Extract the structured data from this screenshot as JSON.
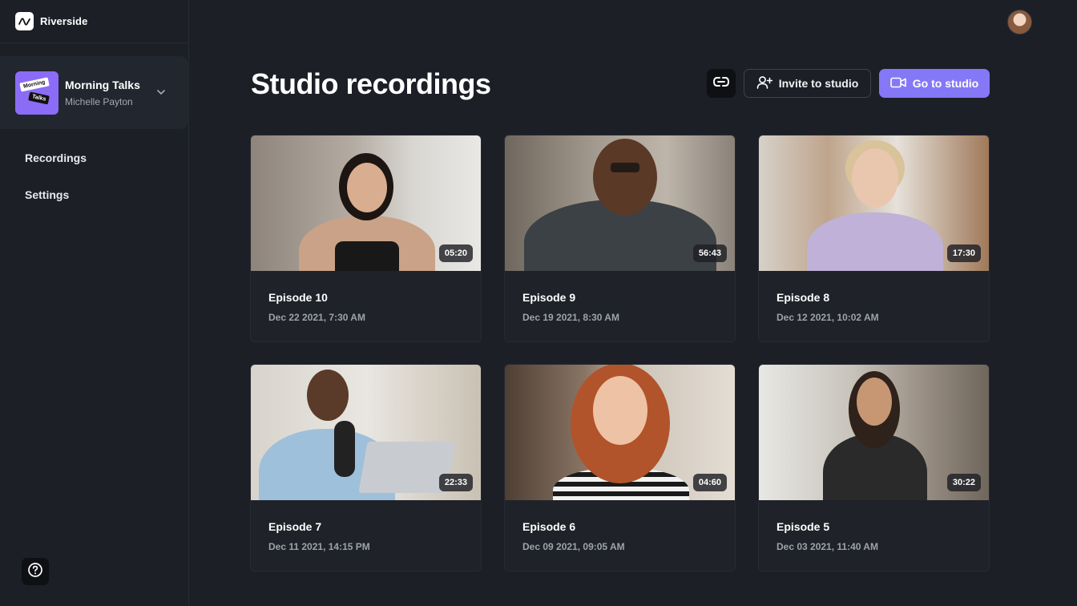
{
  "app": {
    "name": "Riverside"
  },
  "studio": {
    "name": "Morning Talks",
    "owner": "Michelle Payton",
    "thumb_line1": "Morning",
    "thumb_line2": "Talks",
    "thumb_color": "#8b6cf6"
  },
  "nav": {
    "items": [
      {
        "label": "Recordings"
      },
      {
        "label": "Settings"
      }
    ]
  },
  "header": {
    "title": "Studio recordings",
    "invite_label": "Invite to studio",
    "go_label": "Go to studio",
    "accent": "#8578f7"
  },
  "recordings": [
    {
      "title": "Episode 10",
      "date": "Dec 22 2021, 7:30 AM",
      "duration": "05:20"
    },
    {
      "title": "Episode 9",
      "date": "Dec 19 2021, 8:30 AM",
      "duration": "56:43"
    },
    {
      "title": "Episode 8",
      "date": "Dec 12 2021, 10:02 AM",
      "duration": "17:30"
    },
    {
      "title": "Episode 7",
      "date": "Dec 11 2021, 14:15 PM",
      "duration": "22:33"
    },
    {
      "title": "Episode 6",
      "date": "Dec 09 2021, 09:05 AM",
      "duration": "04:60"
    },
    {
      "title": "Episode 5",
      "date": "Dec 03 2021, 11:40 AM",
      "duration": "30:22"
    }
  ],
  "icons": {
    "brand": "riverside-logo-icon",
    "chevron": "chevron-down-icon",
    "help": "help-circle-icon",
    "link": "link-icon",
    "invite": "user-plus-icon",
    "go": "video-camera-icon"
  }
}
